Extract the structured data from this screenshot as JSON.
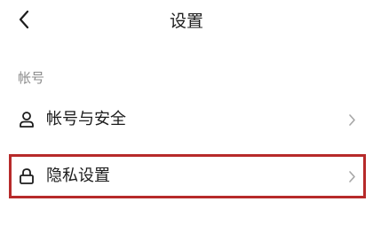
{
  "header": {
    "title": "设置",
    "back_icon": "chevron-left-icon"
  },
  "section": {
    "label": "帐号"
  },
  "items": [
    {
      "label": "帐号与安全",
      "icon": "person-icon",
      "trailing_icon": "chevron-right-icon"
    },
    {
      "label": "隐私设置",
      "icon": "lock-icon",
      "trailing_icon": "chevron-right-icon",
      "highlighted": true
    }
  ],
  "colors": {
    "text": "#1c1c1c",
    "secondary_text": "#8c8c8c",
    "chevron": "#a6a6a6",
    "highlight_border": "#b72a2a"
  }
}
